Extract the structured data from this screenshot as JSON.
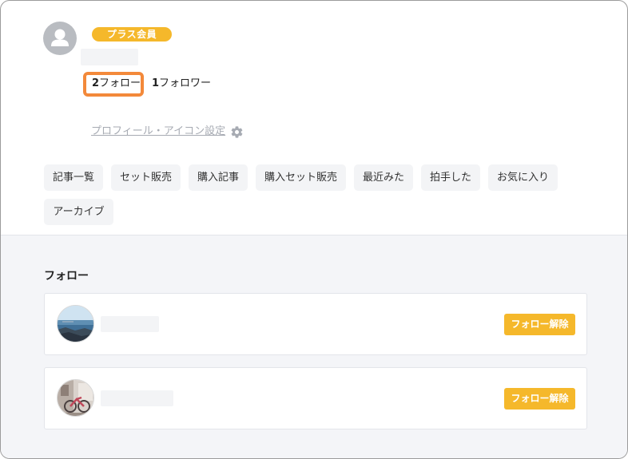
{
  "profile": {
    "badge": "プラス会員",
    "following": {
      "count": "2",
      "label": "フォロー"
    },
    "followers": {
      "count": "1",
      "label": "フォロワー"
    },
    "settings_link": "プロフィール・アイコン設定"
  },
  "tabs": [
    {
      "label": "記事一覧"
    },
    {
      "label": "セット販売"
    },
    {
      "label": "購入記事"
    },
    {
      "label": "購入セット販売"
    },
    {
      "label": "最近みた"
    },
    {
      "label": "拍手した"
    },
    {
      "label": "お気に入り"
    },
    {
      "label": "アーカイブ"
    }
  ],
  "follow_section": {
    "title": "フォロー",
    "users": [
      {
        "unfollow_label": "フォロー解除"
      },
      {
        "unfollow_label": "フォロー解除"
      }
    ]
  },
  "colors": {
    "accent": "#f5b82b",
    "highlight": "#f3893a",
    "tab_bg": "#f3f4f6",
    "lower_bg": "#f4f5f8"
  }
}
